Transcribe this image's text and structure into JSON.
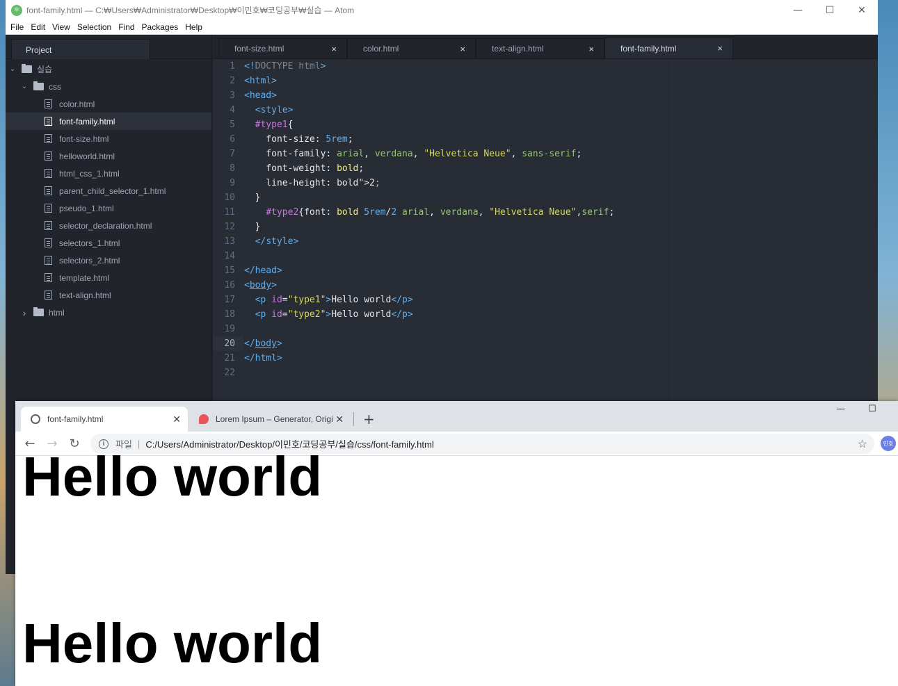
{
  "atom": {
    "title": "font-family.html — C:₩Users₩Administrator₩Desktop₩이민호₩코딩공부₩실습 — Atom",
    "window_controls": [
      "—",
      "☐",
      "✕"
    ],
    "menu": [
      "File",
      "Edit",
      "View",
      "Selection",
      "Find",
      "Packages",
      "Help"
    ],
    "project_tab": "Project",
    "tree": [
      {
        "type": "folder",
        "label": "실습",
        "open": true,
        "depth": 0
      },
      {
        "type": "folder",
        "label": "css",
        "open": true,
        "depth": 1
      },
      {
        "type": "file",
        "label": "color.html"
      },
      {
        "type": "file",
        "label": "font-family.html",
        "selected": true
      },
      {
        "type": "file",
        "label": "font-size.html"
      },
      {
        "type": "file",
        "label": "helloworld.html"
      },
      {
        "type": "file",
        "label": "html_css_1.html"
      },
      {
        "type": "file",
        "label": "parent_child_selector_1.html"
      },
      {
        "type": "file",
        "label": "pseudo_1.html"
      },
      {
        "type": "file",
        "label": "selector_declaration.html"
      },
      {
        "type": "file",
        "label": "selectors_1.html"
      },
      {
        "type": "file",
        "label": "selectors_2.html"
      },
      {
        "type": "file",
        "label": "template.html"
      },
      {
        "type": "file",
        "label": "text-align.html"
      },
      {
        "type": "folder",
        "label": "html",
        "open": false,
        "depth": 1
      }
    ],
    "tabs": [
      {
        "label": "font-size.html",
        "active": false
      },
      {
        "label": "color.html",
        "active": false
      },
      {
        "label": "text-align.html",
        "active": false
      },
      {
        "label": "font-family.html",
        "active": true
      }
    ],
    "tab_close": "×",
    "current_line": 20,
    "code_lines": [
      "<!DOCTYPE html>",
      "<html>",
      "<head>",
      "  <style>",
      "  #type1{",
      "    font-size: 5rem;",
      "    font-family: arial, verdana, \"Helvetica Neue\", sans-serif;",
      "    font-weight: bold;",
      "    line-height: 2;",
      "  }",
      "    #type2{font: bold 5rem/2 arial, verdana, \"Helvetica Neue\",serif;",
      "  }",
      "  </style>",
      "",
      "</head>",
      "<body>",
      "  <p id=\"type1\">Hello world</p>",
      "  <p id=\"type2\">Hello world</p>",
      "",
      "</body>",
      "</html>",
      ""
    ]
  },
  "chrome": {
    "tabs": [
      {
        "label": "font-family.html",
        "active": true,
        "icon": "globe-icon"
      },
      {
        "label": "Lorem Ipsum – Generator, Origi",
        "active": false,
        "icon": "lorem-icon"
      }
    ],
    "tab_close": "✕",
    "new_tab": "+",
    "window_controls": [
      "—",
      "☐"
    ],
    "nav": {
      "back": "←",
      "forward": "→",
      "reload": "↻"
    },
    "omnibox": {
      "scheme_label": "파일",
      "url": "C:/Users/Administrator/Desktop/이민호/코딩공부/실습/css/font-family.html"
    },
    "avatar_label": "민호",
    "page": {
      "type1_text": "Hello world",
      "type2_text": "Hello world"
    }
  }
}
